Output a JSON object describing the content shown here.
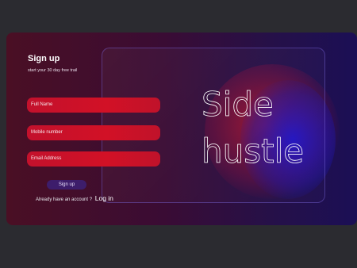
{
  "signup": {
    "title": "Sign up",
    "subtitle": "start your 30 day free trail",
    "fields": {
      "full_name": "Full Name",
      "mobile": "Mobile number",
      "email": "Email Address"
    },
    "button_label": "Sign up",
    "account_prompt": "Already have an account ?",
    "login_link": "Log in"
  },
  "hero": {
    "line1": "Side",
    "line2": "hustle"
  },
  "colors": {
    "field_red": "#d21126",
    "button_purple": "#3d1d6b",
    "background": "#2b2b30"
  }
}
